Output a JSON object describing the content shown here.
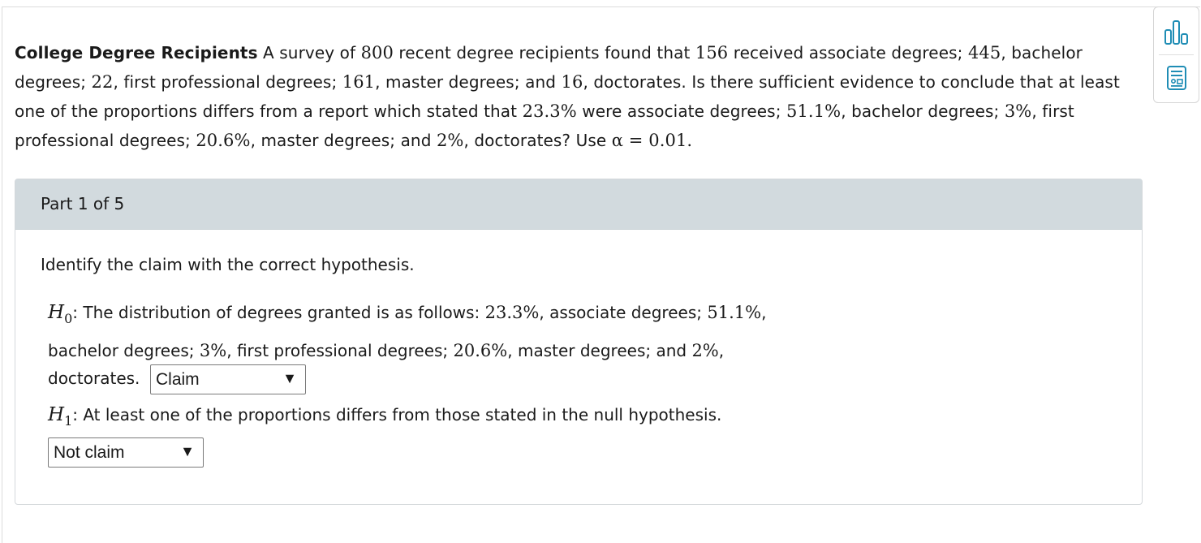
{
  "problem": {
    "title": "College Degree Recipients",
    "seg1": " A survey of ",
    "n1": "800",
    "seg2": " recent degree recipients found that ",
    "n2": "156",
    "seg3": " received associate degrees; ",
    "n3": "445",
    "seg4": ", bachelor degrees; ",
    "n4": "22",
    "seg5": ", first professional degrees; ",
    "n5": "161",
    "seg6": ", master degrees; and ",
    "n6": "16",
    "seg7": ", doctorates. Is there sufficient evidence to conclude that at least one of the proportions differs from a report which stated that ",
    "p1": "23.3%",
    "seg8": " were associate degrees; ",
    "p2": "51.1%",
    "seg9": ", bachelor degrees; ",
    "p3": "3%",
    "seg10": ", first professional degrees; ",
    "p4": "20.6%",
    "seg11": ", master degrees; and ",
    "p5": "2%",
    "seg12": ", doctorates? Use ",
    "alpha": "α = 0.01",
    "end": "."
  },
  "toolbar": {
    "icons": [
      "bar-chart-icon",
      "calculator-icon"
    ],
    "color": "#1f8db5"
  },
  "part": {
    "header": "Part 1 of 5",
    "instruction": "Identify the claim with the correct hypothesis.",
    "h0": {
      "var": "H",
      "sub": "0",
      "l1a": ": The distribution of degrees granted is as follows: ",
      "v1": "23.3%",
      "l1b": ", associate degrees; ",
      "v2": "51.1%",
      "l1c": ",",
      "l2a": "bachelor degrees; ",
      "v3": "3%",
      "l2b": ", first professional degrees; ",
      "v4": "20.6%",
      "l2c": ", master degrees; and ",
      "v5": "2%",
      "l2d": ",",
      "l3": "doctorates.",
      "select_value": "Claim"
    },
    "h1": {
      "var": "H",
      "sub": "1",
      "text": ": At least one of the proportions differs from those stated in the null hypothesis.",
      "select_value": "Not claim"
    },
    "select_arrow": "▼"
  }
}
